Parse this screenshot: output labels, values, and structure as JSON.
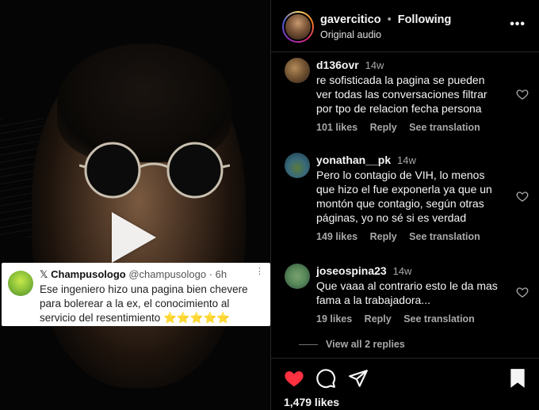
{
  "video": {
    "play_icon": "play-icon",
    "tweet": {
      "brand": "𝕏",
      "name": "Champusologo",
      "handle": "@champusologo",
      "time": "· 6h",
      "more": "⋮",
      "text_before": "Ese ingeniero hizo una pagina bien chevere para bolerear a la ",
      "text_ex": "ex",
      "text_after": ", el conocimiento al servicio del resentimiento ",
      "stars": "⭐⭐⭐⭐⭐"
    }
  },
  "post": {
    "username": "gavercitico",
    "separator": "•",
    "follow_status": "Following",
    "audio": "Original audio",
    "more_icon": "•••"
  },
  "comments": [
    {
      "user": "d136ovr",
      "time": "14w",
      "text": "re sofisticada la pagina se pueden ver todas las conversaciones filtrar por tpo de relacion fecha persona",
      "likes": "101 likes",
      "reply": "Reply",
      "translate": "See translation"
    },
    {
      "user": "yonathan__pk",
      "time": "14w",
      "text": "Pero lo contagio de VIH, lo menos que hizo el fue exponerla ya que un montón que contagio, según otras páginas, yo no sé si es verdad",
      "likes": "149 likes",
      "reply": "Reply",
      "translate": "See translation"
    },
    {
      "user": "joseospina23",
      "time": "14w",
      "text": "Que vaaa al contrario esto le da mas fama a la trabajadora...",
      "likes": "19 likes",
      "reply": "Reply",
      "translate": "See translation"
    }
  ],
  "view_replies": "View all 2 replies",
  "footer": {
    "likes": "1,479 likes",
    "icons": [
      "heart-filled-icon",
      "comment-icon",
      "share-icon",
      "bookmark-icon"
    ],
    "heart_color": "#ff3040"
  }
}
